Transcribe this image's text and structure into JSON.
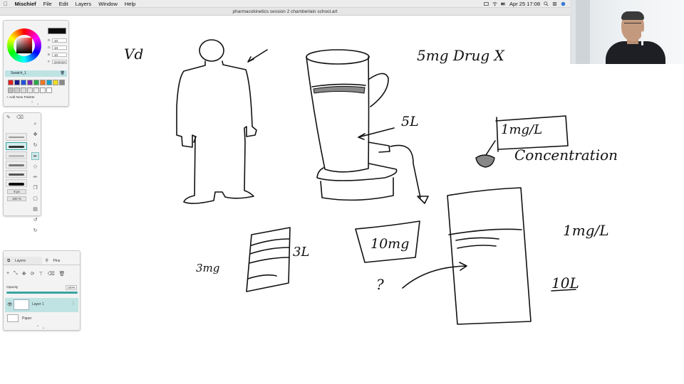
{
  "menubar": {
    "apple": "",
    "app": "Mischief",
    "items": [
      "File",
      "Edit",
      "Layers",
      "Window",
      "Help"
    ],
    "datetime": "Apr 25  17:08"
  },
  "window": {
    "title": "pharmacokinetics session 2 chamberlain school.art"
  },
  "color_panel": {
    "r": "10",
    "g": "10",
    "b": "10",
    "hex": "0A0A0A",
    "current_color": "#0a0a0a",
    "swatch_name": "Swatch_1",
    "swatches": [
      "#e02020",
      "#1a1a8c",
      "#2255dd",
      "#7a2aa8",
      "#2aa84a",
      "#ee7722",
      "#1aa0c8",
      "#eedd22",
      "#888888",
      "#bbbbbb",
      "#cccccc",
      "#dddddd",
      "#e6e6e6",
      "#eeeeee",
      "#f4f4f4",
      "#ffffff"
    ],
    "add_palette": "+ Add New Palette"
  },
  "tools_panel": {
    "size": "8 px",
    "zoom": "100 %"
  },
  "layers_panel": {
    "tab_layers": "Layers",
    "tab_pins": "Pins",
    "opacity_label": "Opacity",
    "opacity_value": "100%",
    "opacity": 1.0,
    "layer_name": "Layer 1",
    "paper_name": "Paper"
  },
  "canvas_text": {
    "vd": "Vd",
    "drug": "5mg  Drug  X",
    "five_l": "5L",
    "one_mg_l": "1mg/L",
    "concentration": "Concentration",
    "three_l": "3L",
    "three_mg": "3mg",
    "ten_mg": "10mg",
    "question": "?",
    "one_mg_l_2": "1mg/L",
    "ten_l": "10L"
  }
}
